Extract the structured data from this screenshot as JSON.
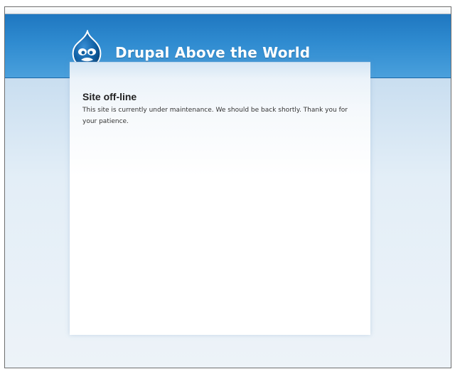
{
  "header": {
    "site_name": "Drupal Above the World",
    "logo_icon": "drupal-drop-icon"
  },
  "main": {
    "title": "Site off-line",
    "message": "This site is currently under maintenance. We should be back shortly. Thank you for your patience."
  },
  "colors": {
    "header_blue": "#2f8bd0",
    "background_light_blue": "#c9def0",
    "logo_dark_blue": "#0d5a9a"
  }
}
